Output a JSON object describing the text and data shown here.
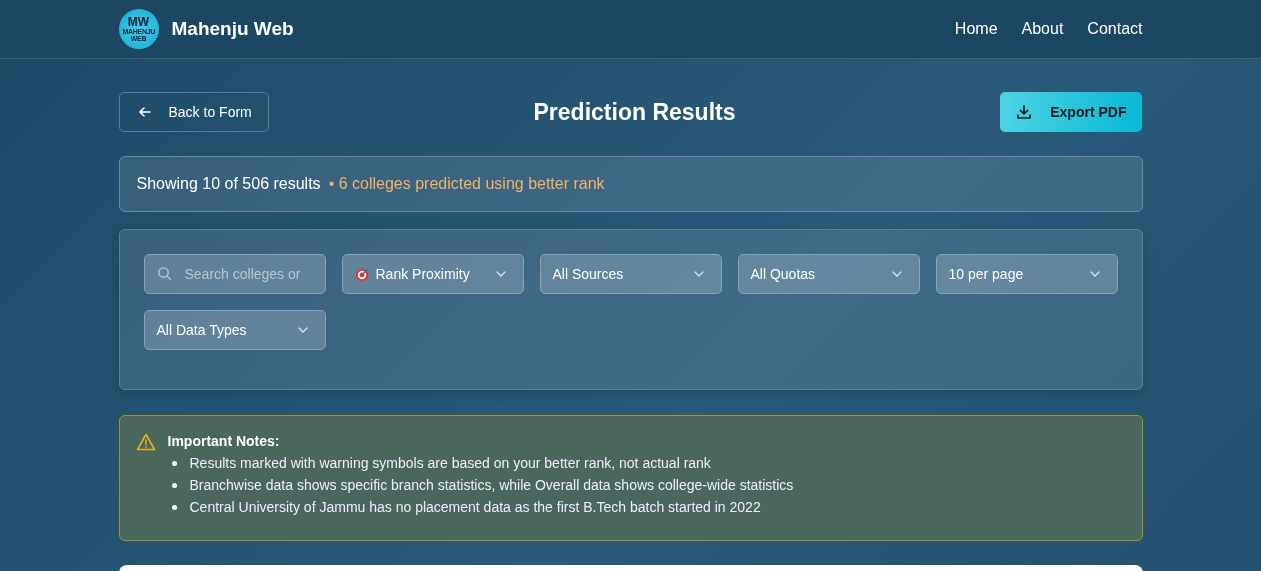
{
  "brand": {
    "name": "Mahenju Web",
    "logo_text": "MW",
    "logo_subtext": "MAHENJU WEB"
  },
  "nav": [
    "Home",
    "About",
    "Contact"
  ],
  "back_button": "Back to Form",
  "title": "Prediction Results",
  "export_button": "Export PDF",
  "summary": {
    "text": "Showing 10 of 506 results",
    "note": "• 6 colleges predicted using better rank"
  },
  "filters": [
    {
      "kind": "search",
      "placeholder": "Search colleges or"
    },
    {
      "kind": "targetselect",
      "value": "Rank Proximity"
    },
    {
      "kind": "select",
      "value": "All Sources"
    },
    {
      "kind": "select",
      "value": "All Quotas"
    },
    {
      "kind": "select",
      "value": "10 per page"
    },
    {
      "kind": "select",
      "value": "All Data Types"
    }
  ],
  "notes": {
    "title": "Important Notes:",
    "items": [
      "Results marked with warning symbols are based on your better rank, not actual rank",
      "Branchwise data shows specific branch statistics, while Overall data shows college-wide statistics",
      "Central University of Jammu has no placement data as the first B.Tech batch started in 2022"
    ]
  }
}
